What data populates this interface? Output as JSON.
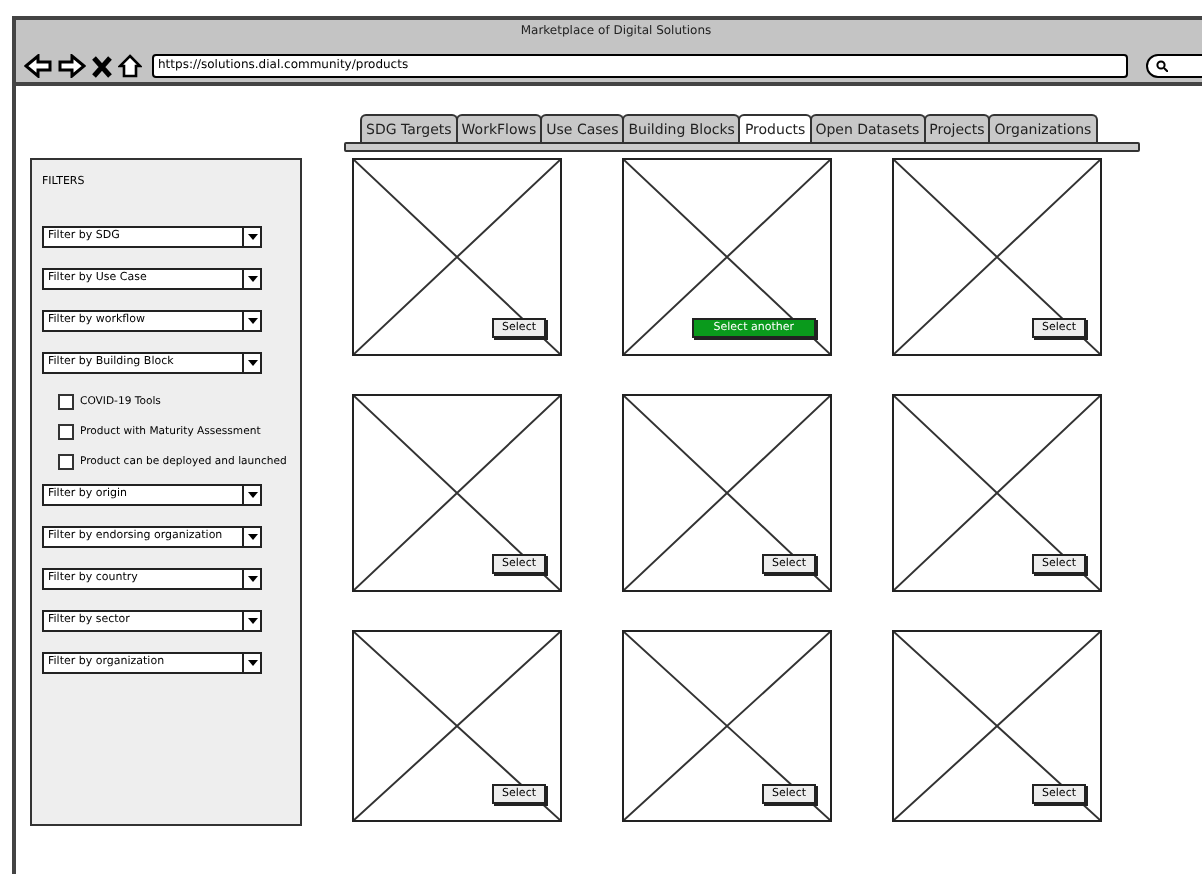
{
  "window": {
    "title": "Marketplace of Digital Solutions",
    "url": "https://solutions.dial.community/products"
  },
  "tabs": [
    {
      "label": "SDG Targets",
      "selected": false
    },
    {
      "label": "WorkFlows",
      "selected": false
    },
    {
      "label": "Use Cases",
      "selected": false
    },
    {
      "label": "Building Blocks",
      "selected": false
    },
    {
      "label": "Products",
      "selected": true
    },
    {
      "label": "Open Datasets",
      "selected": false
    },
    {
      "label": "Projects",
      "selected": false
    },
    {
      "label": "Organizations",
      "selected": false
    }
  ],
  "sidebar": {
    "title": "FILTERS",
    "items": [
      {
        "kind": "select",
        "label": "Filter by SDG"
      },
      {
        "kind": "select",
        "label": "Filter by Use Case"
      },
      {
        "kind": "select",
        "label": "Filter by workflow"
      },
      {
        "kind": "select",
        "label": "Filter by Building Block"
      },
      {
        "kind": "checkbox",
        "label": "COVID-19 Tools",
        "checked": false
      },
      {
        "kind": "checkbox",
        "label": "Product with Maturity Assessment",
        "checked": false
      },
      {
        "kind": "checkbox",
        "label": "Product can be deployed and launched",
        "checked": false
      },
      {
        "kind": "select",
        "label": "Filter by origin"
      },
      {
        "kind": "select",
        "label": "Filter by endorsing organization"
      },
      {
        "kind": "select",
        "label": "Filter by country"
      },
      {
        "kind": "select",
        "label": "Filter by sector"
      },
      {
        "kind": "select",
        "label": "Filter by organization"
      }
    ]
  },
  "products": [
    {
      "button": "Select",
      "selected": false
    },
    {
      "button": "Select another",
      "selected": true
    },
    {
      "button": "Select",
      "selected": false
    },
    {
      "button": "Select",
      "selected": false
    },
    {
      "button": "Select",
      "selected": false
    },
    {
      "button": "Select",
      "selected": false
    },
    {
      "button": "Select",
      "selected": false
    },
    {
      "button": "Select",
      "selected": false
    },
    {
      "button": "Select",
      "selected": false
    }
  ]
}
